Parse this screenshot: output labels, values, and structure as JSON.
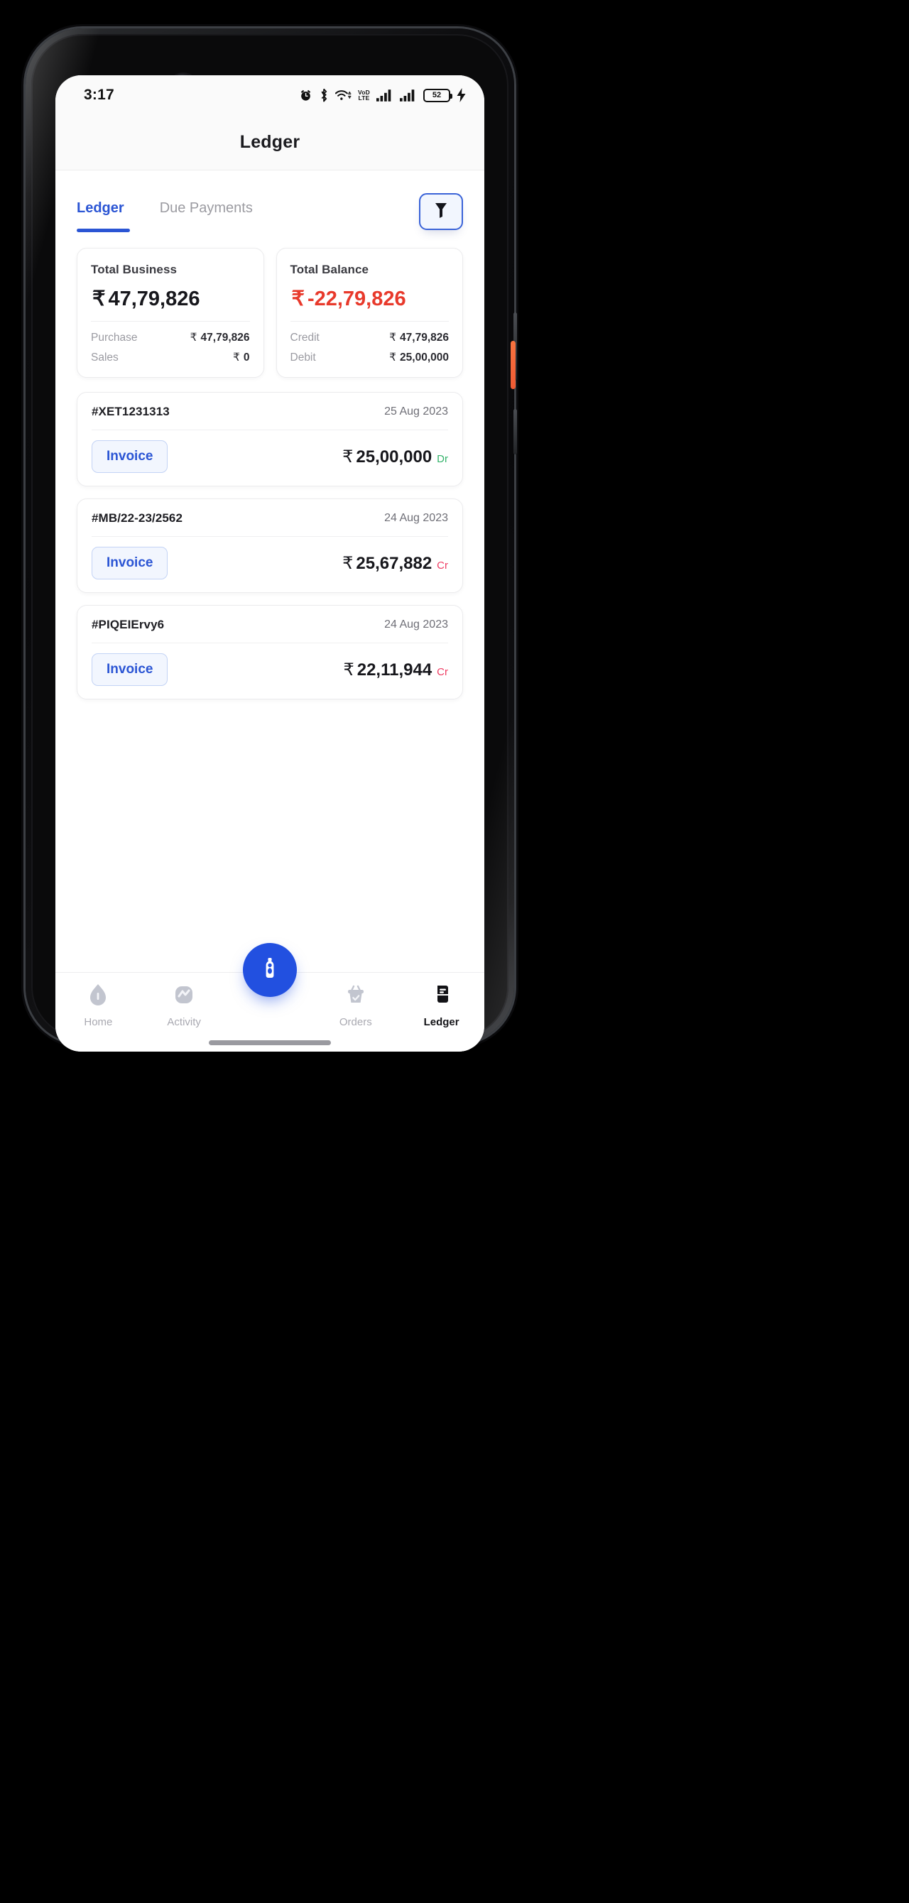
{
  "status_bar": {
    "time": "3:17",
    "battery_percent": "52",
    "volte_line1": "VoD",
    "volte_line2": "LTE",
    "icons": [
      "alarm-icon",
      "bluetooth-icon",
      "wifi-icon",
      "volte-icon",
      "signal-icon-sim1",
      "signal-icon-sim2",
      "battery-icon",
      "charging-bolt-icon"
    ]
  },
  "app_bar": {
    "title": "Ledger"
  },
  "tabs": {
    "items": [
      {
        "label": "Ledger",
        "active": true
      },
      {
        "label": "Due Payments",
        "active": false
      }
    ],
    "filter_icon": "filter-funnel-icon"
  },
  "summary": {
    "business": {
      "label": "Total Business",
      "currency": "₹",
      "amount": "47,79,826",
      "rows": [
        {
          "key": "Purchase",
          "currency": "₹",
          "value": "47,79,826"
        },
        {
          "key": "Sales",
          "currency": "₹",
          "value": "0"
        }
      ]
    },
    "balance": {
      "label": "Total Balance",
      "currency": "₹",
      "amount": "-22,79,826",
      "amount_color": "#e8392b",
      "rows": [
        {
          "key": "Credit",
          "currency": "₹",
          "value": "47,79,826"
        },
        {
          "key": "Debit",
          "currency": "₹",
          "value": "25,00,000"
        }
      ]
    }
  },
  "transactions": [
    {
      "id": "#XET1231313",
      "date": "25 Aug 2023",
      "button_label": "Invoice",
      "currency": "₹",
      "amount": "25,00,000",
      "tag": "Dr",
      "tag_type": "dr"
    },
    {
      "id": "#MB/22-23/2562",
      "date": "24 Aug 2023",
      "button_label": "Invoice",
      "currency": "₹",
      "amount": "25,67,882",
      "tag": "Cr",
      "tag_type": "cr"
    },
    {
      "id": "#PIQEIErvy6",
      "date": "24 Aug 2023",
      "button_label": "Invoice",
      "currency": "₹",
      "amount": "22,11,944",
      "tag": "Cr",
      "tag_type": "cr"
    }
  ],
  "bottom_nav": {
    "items": [
      {
        "label": "Home",
        "icon": "home-icon",
        "active": false
      },
      {
        "label": "Activity",
        "icon": "activity-pulse-icon",
        "active": false
      },
      {
        "label": "Orders",
        "icon": "basket-check-icon",
        "active": false
      },
      {
        "label": "Ledger",
        "icon": "ledger-book-icon",
        "active": true
      }
    ],
    "fab_icon": "bottle-camera-icon"
  },
  "colors": {
    "accent_blue": "#2b55d4",
    "fab_blue": "#2250e0",
    "negative_red": "#e8392b",
    "credit_pink": "#ef3d63",
    "debit_green": "#34b36b"
  }
}
